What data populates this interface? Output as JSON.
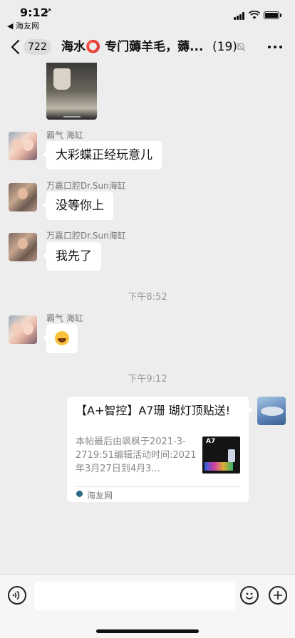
{
  "status_bar": {
    "time": "9:12",
    "back_app": "◀ 海友网"
  },
  "header": {
    "unread_count": "722",
    "title": "海水⭕️ 专门薅羊毛，薅...",
    "member_count": "(19)"
  },
  "messages": [
    {
      "type": "image",
      "sender": ""
    },
    {
      "type": "text",
      "sender": "霸气 海缸",
      "avatar": "kids-avatar",
      "text": "大彩蝶正经玩意儿"
    },
    {
      "type": "text",
      "sender": "万嘉口腔Dr.Sun海缸",
      "avatar": "doctor-avatar",
      "text": "没等你上"
    },
    {
      "type": "text",
      "sender": "万嘉口腔Dr.Sun海缸",
      "avatar": "doctor-avatar",
      "text": "我先了"
    },
    {
      "type": "timestamp",
      "text": "下午8:52"
    },
    {
      "type": "emoji",
      "sender": "霸气 海缸",
      "avatar": "kids-avatar",
      "emoji": "laughing-emoji"
    },
    {
      "type": "timestamp",
      "text": "下午9:12"
    },
    {
      "type": "link_card",
      "title": "【A+智控】A7珊 瑚灯顶贴送!",
      "description": "本帖最后由飒枫于2021-3-2719:51编辑活动时间:2021年3月27日到4月3...",
      "source": "海友网",
      "thumbnail_text": "A7"
    }
  ],
  "input_bar": {
    "voice_icon": "voice-icon",
    "emoji_icon": "smile-icon",
    "plus_icon": "plus-icon"
  },
  "colors": {
    "background": "#ededed",
    "bubble": "#ffffff",
    "timestamp": "#999999"
  }
}
